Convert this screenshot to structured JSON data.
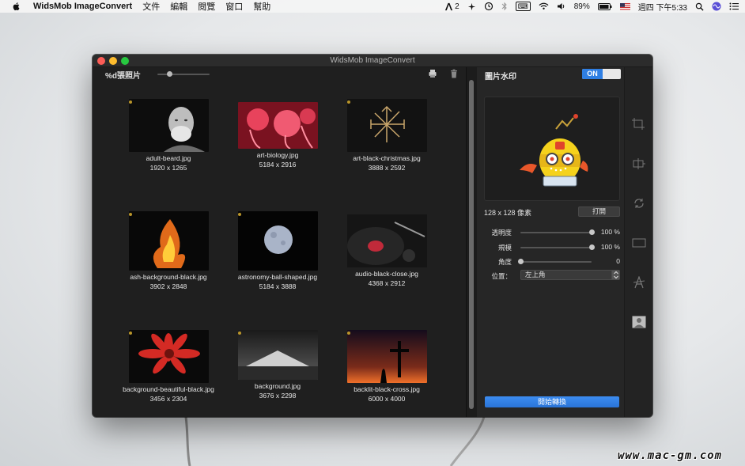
{
  "menubar": {
    "app_name": "WidsMob ImageConvert",
    "menus": [
      "文件",
      "編輯",
      "閱覽",
      "窗口",
      "幫助"
    ],
    "adobe_count": "2",
    "battery": "89%",
    "clock": "週四 下午5:33"
  },
  "window": {
    "title": "WidsMob ImageConvert"
  },
  "left_pane": {
    "count_label": "%d張照片",
    "images": [
      {
        "name": "adult-beard.jpg",
        "size": "1920 x 1265"
      },
      {
        "name": "art-biology.jpg",
        "size": "5184 x 2916"
      },
      {
        "name": "art-black-christmas.jpg",
        "size": "3888 x 2592"
      },
      {
        "name": "ash-background-black.jpg",
        "size": "3902 x 2848"
      },
      {
        "name": "astronomy-ball-shaped.jpg",
        "size": "5184 x 3888"
      },
      {
        "name": "audio-black-close.jpg",
        "size": "4368 x 2912"
      },
      {
        "name": "background-beautiful-black.jpg",
        "size": "3456 x 2304"
      },
      {
        "name": "background.jpg",
        "size": "3676 x 2298"
      },
      {
        "name": "backlit-black-cross.jpg",
        "size": "6000 x 4000"
      }
    ]
  },
  "right_pane": {
    "title": "圖片水印",
    "toggle_label": "ON",
    "preview_size": "128 x 128 像素",
    "open_button": "打開",
    "opacity": {
      "label": "透明度",
      "value": "100 %",
      "level": 1.0
    },
    "scale": {
      "label": "規模",
      "value": "100 %",
      "level": 1.0
    },
    "angle": {
      "label": "角度",
      "value": "0",
      "level": 0.0
    },
    "position": {
      "label": "位置：",
      "value": "左上角"
    },
    "start_button": "開始轉換"
  },
  "side_icons": [
    "crop-icon",
    "resize-icon",
    "rotate-icon",
    "border-icon",
    "text-watermark-icon",
    "image-watermark-icon"
  ],
  "site_watermark": "www.mac-gm.com"
}
